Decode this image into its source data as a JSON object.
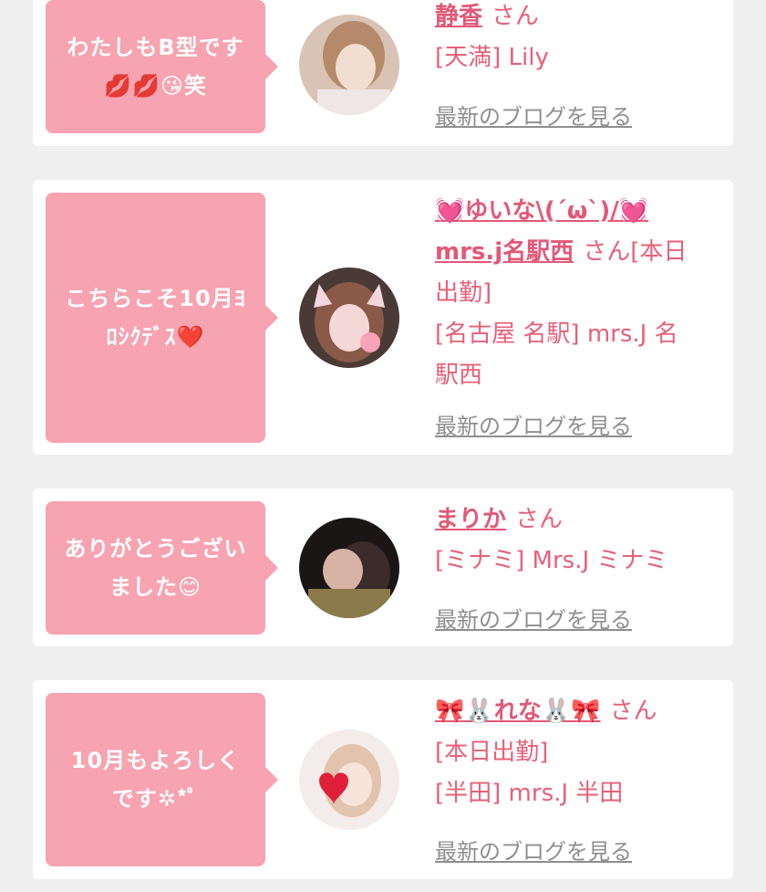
{
  "san_label": "さん",
  "blog_link_label": "最新のブログを見る",
  "colors": {
    "bubble": "#f7a3b1",
    "name": "#e35877",
    "text": "#e8607b",
    "link": "#8f8f8f",
    "background": "#efefef"
  },
  "comments": [
    {
      "message": "わたしもB型です\n💋💋😘笑",
      "name": "静香",
      "meta_lines": [
        "[天満] Lily"
      ]
    },
    {
      "message": "こちらこそ10月ﾖ\nﾛｼｸﾃﾞｽ❤️",
      "name_line1": "💓ゆいな\\(´ω`)/💓",
      "name_line2": "mrs.j名駅西",
      "san_suffix": "[本日",
      "meta_lines": [
        "出勤]",
        "[名古屋 名駅] mrs.J 名",
        "駅西"
      ]
    },
    {
      "message": "ありがとうござい\nました😊",
      "name": "まりか",
      "meta_lines": [
        "[ミナミ] Mrs.J ミナミ"
      ]
    },
    {
      "message": "10月もよろしく\nです✲*ﾟ",
      "name": "🎀🐰れな🐰🎀",
      "meta_lines": [
        "[本日出勤]",
        "[半田] mrs.J 半田"
      ]
    }
  ]
}
